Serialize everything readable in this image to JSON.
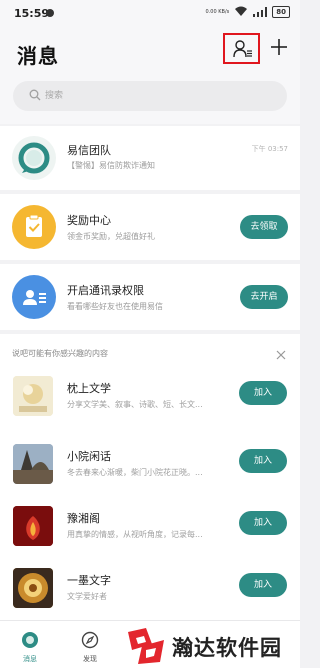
{
  "status_bar": {
    "time": "15:59",
    "network_info": "0.00 KB/s",
    "battery": "80"
  },
  "header": {
    "title": "消息"
  },
  "search": {
    "placeholder": "搜索"
  },
  "team": {
    "name": "易信团队",
    "message": "【警惕】易信防欺诈通知",
    "time": "下午 03:57"
  },
  "reward": {
    "name": "奖励中心",
    "desc": "领金币奖励，兑超值好礼",
    "button": "去领取"
  },
  "permission": {
    "name": "开启通讯录权限",
    "desc": "看看哪些好友也在使用易信",
    "button": "去开启"
  },
  "suggestions": {
    "heading": "说吧可能有你感兴趣的内容",
    "join_label": "加入",
    "items": [
      {
        "name": "枕上文学",
        "desc": "分享文学美、叙事、诗歌、短、长文..."
      },
      {
        "name": "小院闲话",
        "desc": "冬去春来心渐暖，柴门小院花正晓。..."
      },
      {
        "name": "豫湘阁",
        "desc": "用真挚的情感，从视听角度，记录每..."
      },
      {
        "name": "一墨文字",
        "desc": "文学爱好者"
      }
    ]
  },
  "tabbar": {
    "messages": "消息",
    "discover": "发现"
  },
  "watermark": {
    "text": "瀚达软件园"
  },
  "colors": {
    "accent": "#2d8c85",
    "highlight_box": "#e0161e",
    "reward_icon": "#f5b731",
    "permission_icon": "#4a90e2"
  }
}
